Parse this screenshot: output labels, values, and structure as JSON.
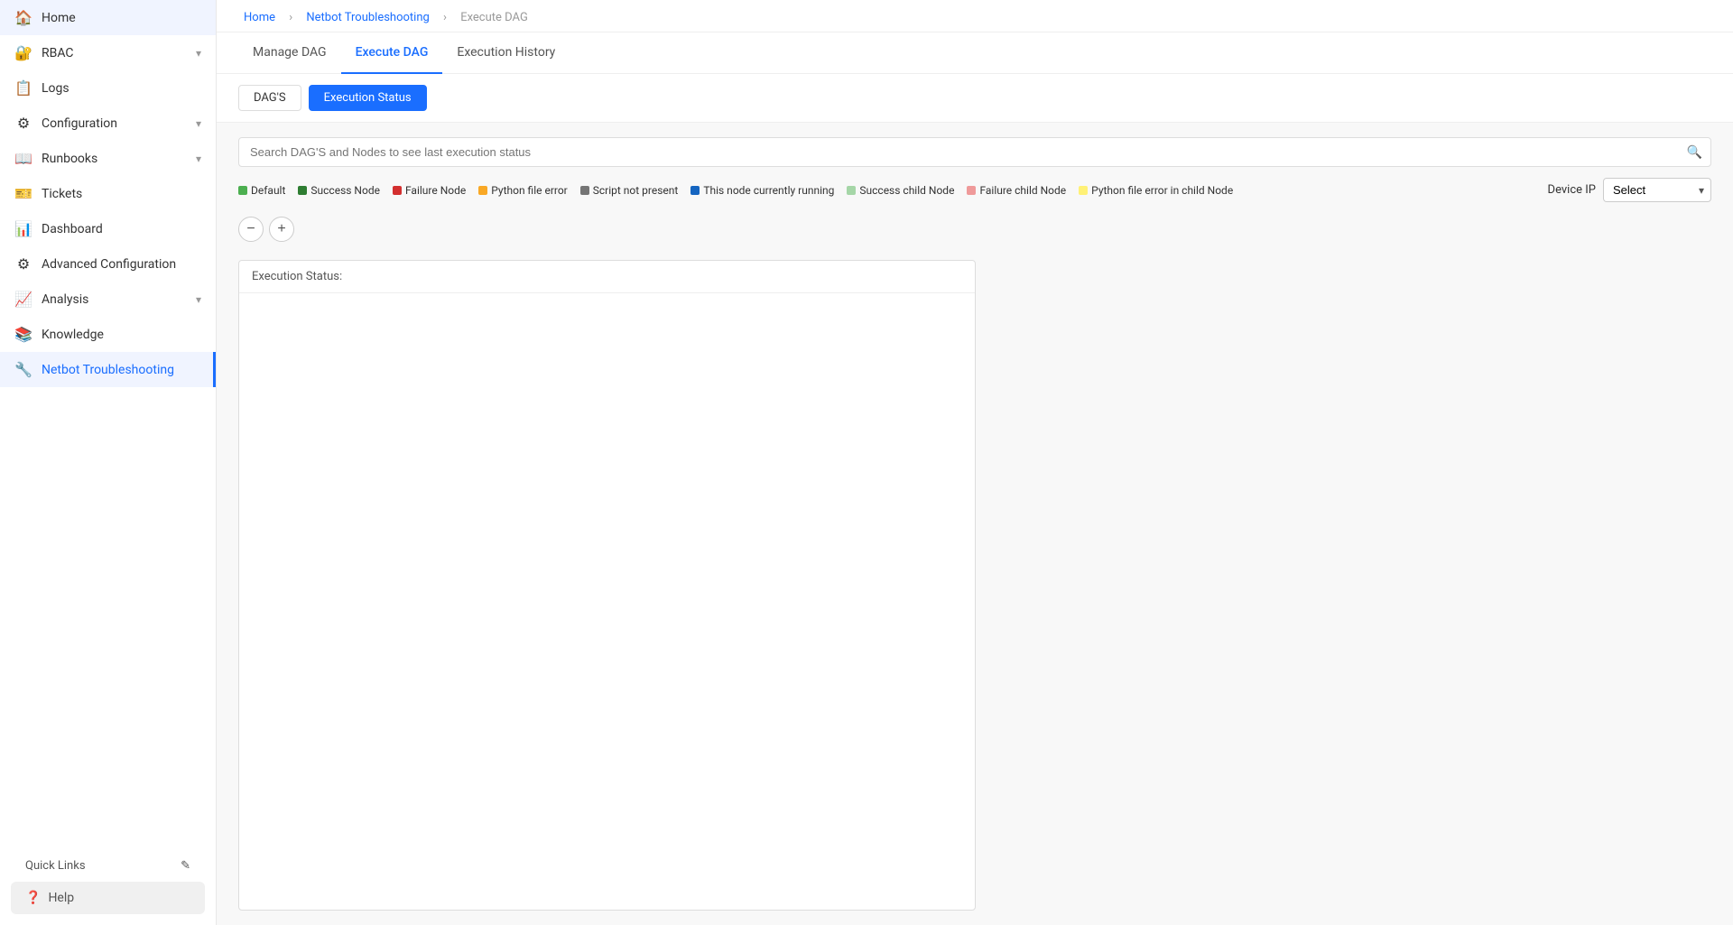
{
  "sidebar": {
    "items": [
      {
        "id": "home",
        "label": "Home",
        "icon": "🏠",
        "hasChevron": false,
        "active": false
      },
      {
        "id": "rbac",
        "label": "RBAC",
        "icon": "🔐",
        "hasChevron": true,
        "active": false
      },
      {
        "id": "logs",
        "label": "Logs",
        "icon": "📋",
        "hasChevron": false,
        "active": false
      },
      {
        "id": "configuration",
        "label": "Configuration",
        "icon": "⚙",
        "hasChevron": true,
        "active": false
      },
      {
        "id": "runbooks",
        "label": "Runbooks",
        "icon": "📖",
        "hasChevron": true,
        "active": false
      },
      {
        "id": "tickets",
        "label": "Tickets",
        "icon": "🎫",
        "hasChevron": false,
        "active": false
      },
      {
        "id": "dashboard",
        "label": "Dashboard",
        "icon": "📊",
        "hasChevron": false,
        "active": false
      },
      {
        "id": "advanced-configuration",
        "label": "Advanced Configuration",
        "icon": "⚙",
        "hasChevron": false,
        "active": false
      },
      {
        "id": "analysis",
        "label": "Analysis",
        "icon": "📈",
        "hasChevron": true,
        "active": false
      },
      {
        "id": "knowledge",
        "label": "Knowledge",
        "icon": "📚",
        "hasChevron": false,
        "active": false
      },
      {
        "id": "netbot-troubleshooting",
        "label": "Netbot Troubleshooting",
        "icon": "🔧",
        "hasChevron": false,
        "active": true
      }
    ],
    "quick_links_label": "Quick Links",
    "help_label": "Help"
  },
  "breadcrumb": {
    "items": [
      {
        "label": "Home",
        "link": true
      },
      {
        "label": "Netbot Troubleshooting",
        "link": true
      },
      {
        "label": "Execute DAG",
        "link": false
      }
    ]
  },
  "tabs": [
    {
      "id": "manage-dag",
      "label": "Manage DAG",
      "active": false
    },
    {
      "id": "execute-dag",
      "label": "Execute DAG",
      "active": true
    },
    {
      "id": "execution-history",
      "label": "Execution History",
      "active": false
    }
  ],
  "sub_tabs": [
    {
      "id": "dags",
      "label": "DAG'S",
      "active": false
    },
    {
      "id": "execution-status",
      "label": "Execution Status",
      "active": true
    }
  ],
  "search": {
    "placeholder": "Search DAG'S and Nodes to see last execution status"
  },
  "legend": [
    {
      "id": "default",
      "label": "Default",
      "color": "#4CAF50"
    },
    {
      "id": "success-node",
      "label": "Success Node",
      "color": "#2e7d32"
    },
    {
      "id": "failure-node",
      "label": "Failure Node",
      "color": "#d32f2f"
    },
    {
      "id": "python-file-error",
      "label": "Python file error",
      "color": "#f9a825"
    },
    {
      "id": "script-not-present",
      "label": "Script not present",
      "color": "#757575"
    },
    {
      "id": "currently-running",
      "label": "This node currently running",
      "color": "#1565c0"
    },
    {
      "id": "success-child-node",
      "label": "Success child Node",
      "color": "#a5d6a7"
    },
    {
      "id": "failure-child-node",
      "label": "Failure child Node",
      "color": "#ef9a9a"
    },
    {
      "id": "python-error-child",
      "label": "Python file error in child Node",
      "color": "#fff176"
    }
  ],
  "device_ip": {
    "label": "Device IP",
    "placeholder": "Select",
    "options": [
      "Select"
    ]
  },
  "execution_panel": {
    "header": "Execution Status:",
    "zoom_in_label": "+",
    "zoom_out_label": "-"
  }
}
